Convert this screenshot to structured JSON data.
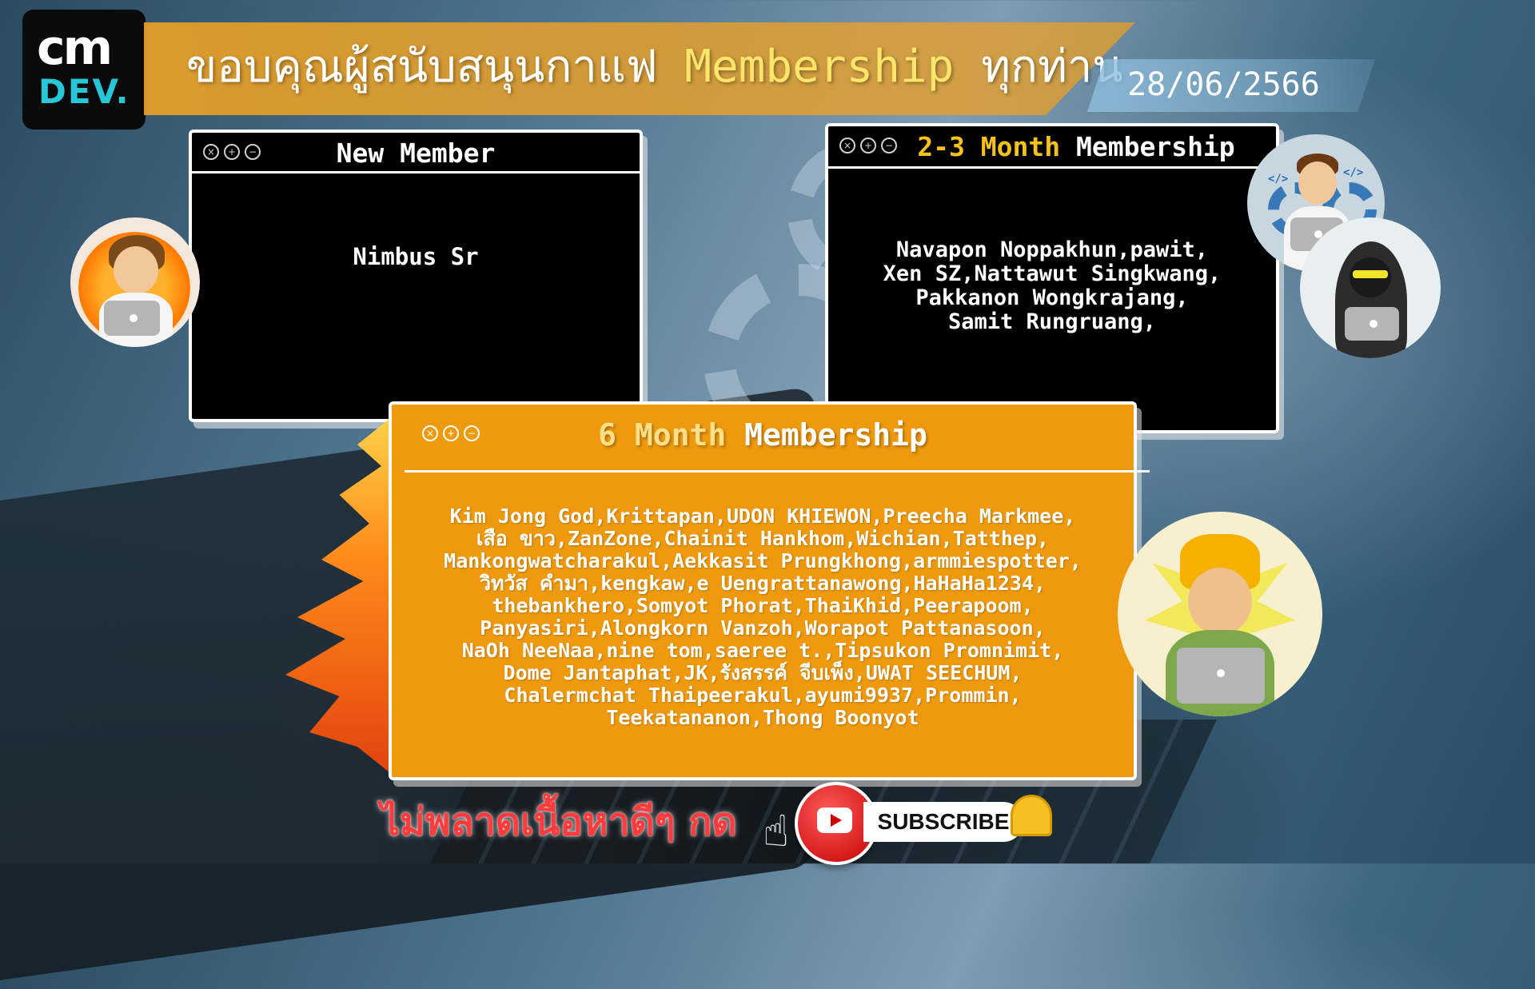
{
  "logo": {
    "top": "cm",
    "bottom": "DEV."
  },
  "banner": {
    "title_pre": "ขอบคุณผู้สนับสนุนกาแฟ ",
    "title_hl": "Membership",
    "title_post": " ทุกท่าน",
    "date": "28/06/2566"
  },
  "windows": {
    "new_member": {
      "title": "New Member",
      "names": "Nimbus Sr"
    },
    "two_three": {
      "title_accent": "2-3 Month",
      "title_rest": " Membership",
      "names": [
        "Navapon Noppakhun,pawit,",
        "Xen SZ,Nattawut Singkwang,",
        "Pakkanon Wongkrajang,",
        "Samit Rungruang,"
      ]
    },
    "six_month": {
      "title_accent": "6 Month",
      "title_rest": " Membership",
      "names": [
        "Kim Jong God,Krittapan,UDON KHIEWON,Preecha Markmee,",
        "เสือ ขาว,ZanZone,Chainit Hankhom,Wichian,Tatthep,",
        "Mankongwatcharakul,Aekkasit Prungkhong,armmiespotter,",
        "วิทวัส คำมา,kengkaw,e Uengrattanawong,HaHaHa1234,",
        "thebankhero,Somyot Phorat,ThaiKhid,Peerapoom,",
        "Panyasiri,Alongkorn Vanzoh,Worapot Pattanasoon,",
        "NaOh NeeNaa,nine tom,saeree t.,Tipsukon Promnimit,",
        "Dome Jantaphat,JK,รังสรรค์ จีบเพ็ง,UWAT SEECHUM,",
        "Chalermchat Thaipeerakul,ayumi9937,Prommin,",
        "Teekatananon,Thong Boonyot"
      ]
    }
  },
  "window_controls": [
    "×",
    "+",
    "−"
  ],
  "cta": {
    "text": "ไม่พลาดเนื้อหาดีๆ กด",
    "subscribe": "SUBSCRIBE"
  },
  "code_tags": {
    "left": "</>",
    "right": "</>"
  },
  "colors": {
    "orange": "#ef9a0e",
    "gold": "#f5c21a",
    "banner": "#e8a028",
    "cta_red": "#ff3b3b"
  }
}
